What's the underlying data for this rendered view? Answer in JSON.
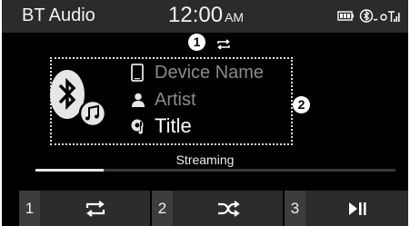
{
  "status_bar": {
    "source_label": "BT Audio",
    "time": "12:00",
    "ampm": "AM",
    "icons": [
      "battery-icon",
      "bluetooth-connected-icon",
      "signal-icon"
    ]
  },
  "callouts": {
    "one": "1",
    "two": "2"
  },
  "now_playing": {
    "repeat_mode_icon": "repeat-icon",
    "device_name": "Device Name",
    "artist": "Artist",
    "title": "Title",
    "art_icon": "bluetooth-audio-icon"
  },
  "streaming_label": "Streaming",
  "progress": {
    "fraction": 0.19
  },
  "bottom_buttons": [
    {
      "number": "1",
      "icon": "repeat-icon"
    },
    {
      "number": "2",
      "icon": "shuffle-icon"
    },
    {
      "number": "3",
      "icon": "play-pause-icon"
    }
  ],
  "colors": {
    "background": "#000000",
    "status_bar": "#2b2b2b",
    "button_bg": "#2c2c2c",
    "key_number_bg": "#3d3d3d",
    "dim_text": "#8a8a8a",
    "text": "#ffffff"
  }
}
